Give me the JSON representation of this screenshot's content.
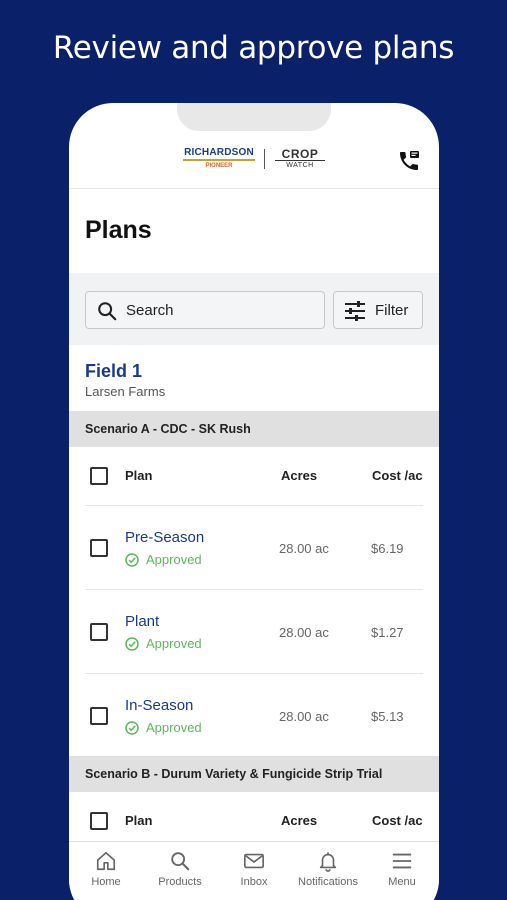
{
  "headline": "Review and approve plans",
  "header": {
    "logo_richardson": "RICHARDSON",
    "logo_pioneer": "PIONEER",
    "logo_crop": "CROP",
    "logo_watch": "WATCH"
  },
  "page_title": "Plans",
  "search": {
    "placeholder": "Search"
  },
  "filter_label": "Filter",
  "field": {
    "name": "Field 1",
    "farm": "Larsen Farms"
  },
  "columns": {
    "plan": "Plan",
    "acres": "Acres",
    "cost": "Cost /ac"
  },
  "scenarios": [
    {
      "title": "Scenario A - CDC - SK Rush",
      "plans": [
        {
          "name": "Pre-Season",
          "status": "Approved",
          "acres": "28.00 ac",
          "cost": "$6.19"
        },
        {
          "name": "Plant",
          "status": "Approved",
          "acres": "28.00 ac",
          "cost": "$1.27"
        },
        {
          "name": "In-Season",
          "status": "Approved",
          "acres": "28.00 ac",
          "cost": "$5.13"
        }
      ]
    },
    {
      "title": "Scenario B - Durum Variety & Fungicide Strip Trial",
      "plans": []
    }
  ],
  "nav": [
    {
      "label": "Home",
      "icon": "home-icon"
    },
    {
      "label": "Products",
      "icon": "search-icon"
    },
    {
      "label": "Inbox",
      "icon": "mail-icon"
    },
    {
      "label": "Notifications",
      "icon": "bell-icon"
    },
    {
      "label": "Menu",
      "icon": "menu-icon"
    }
  ],
  "colors": {
    "background": "#0a2169",
    "link_blue": "#1a3a8a",
    "approved_green": "#5cb85c",
    "scenario_bar": "#e0e0e0"
  }
}
